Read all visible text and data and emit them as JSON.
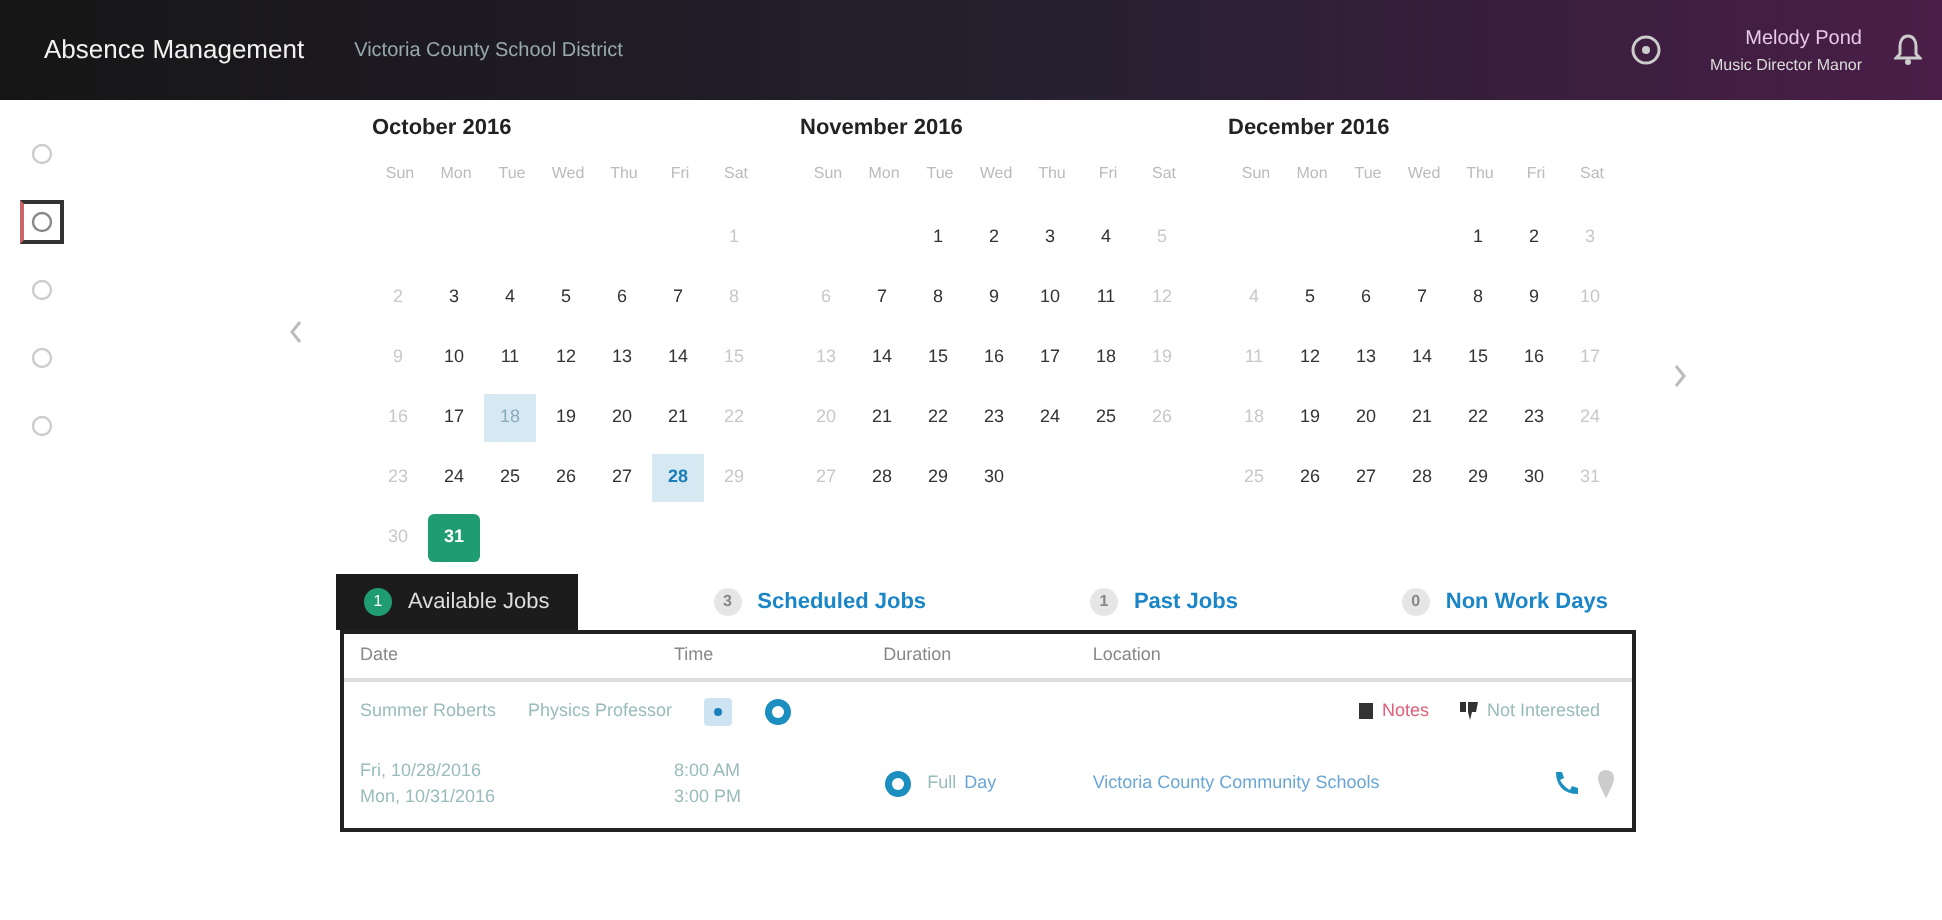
{
  "header": {
    "title": "Absence Management",
    "district": "Victoria County School District",
    "user_name": "Melody Pond",
    "user_role": "Music Director Manor"
  },
  "sidebar": {
    "items": [
      {
        "selected": false
      },
      {
        "selected": true
      },
      {
        "selected": false
      },
      {
        "selected": false
      },
      {
        "selected": false
      }
    ]
  },
  "months": [
    {
      "title": "October 2016",
      "weekdays": [
        "Sun",
        "Mon",
        "Tue",
        "Wed",
        "Thu",
        "Fri",
        "Sat"
      ],
      "weeks": [
        [
          {
            "kind": "blank"
          },
          {
            "kind": "blank"
          },
          {
            "kind": "blank"
          },
          {
            "kind": "blank"
          },
          {
            "kind": "blank"
          },
          {
            "kind": "blank"
          },
          {
            "text": "1",
            "kind": "weekend"
          }
        ],
        [
          {
            "text": "2",
            "kind": "weekend"
          },
          {
            "text": "3",
            "kind": "day"
          },
          {
            "text": "4",
            "kind": "day"
          },
          {
            "text": "5",
            "kind": "day"
          },
          {
            "text": "6",
            "kind": "day"
          },
          {
            "text": "7",
            "kind": "day"
          },
          {
            "text": "8",
            "kind": "weekend"
          }
        ],
        [
          {
            "text": "9",
            "kind": "weekend"
          },
          {
            "text": "10",
            "kind": "day"
          },
          {
            "text": "11",
            "kind": "day"
          },
          {
            "text": "12",
            "kind": "day"
          },
          {
            "text": "13",
            "kind": "day"
          },
          {
            "text": "14",
            "kind": "day"
          },
          {
            "text": "15",
            "kind": "weekend"
          }
        ],
        [
          {
            "text": "16",
            "kind": "weekend"
          },
          {
            "text": "17",
            "kind": "day"
          },
          {
            "text": "18",
            "kind": "light"
          },
          {
            "text": "19",
            "kind": "day"
          },
          {
            "text": "20",
            "kind": "day"
          },
          {
            "text": "21",
            "kind": "day"
          },
          {
            "text": "22",
            "kind": "weekend"
          }
        ],
        [
          {
            "text": "23",
            "kind": "weekend"
          },
          {
            "text": "24",
            "kind": "day"
          },
          {
            "text": "25",
            "kind": "day"
          },
          {
            "text": "26",
            "kind": "day"
          },
          {
            "text": "27",
            "kind": "day"
          },
          {
            "text": "28",
            "kind": "job"
          },
          {
            "text": "29",
            "kind": "weekend"
          }
        ],
        [
          {
            "text": "30",
            "kind": "weekend"
          },
          {
            "text": "31",
            "kind": "today"
          }
        ]
      ]
    },
    {
      "title": "November 2016",
      "weekdays": [
        "Sun",
        "Mon",
        "Tue",
        "Wed",
        "Thu",
        "Fri",
        "Sat"
      ],
      "weeks": [
        [
          {
            "kind": "blank"
          },
          {
            "kind": "blank"
          },
          {
            "text": "1",
            "kind": "day"
          },
          {
            "text": "2",
            "kind": "day"
          },
          {
            "text": "3",
            "kind": "day"
          },
          {
            "text": "4",
            "kind": "day"
          },
          {
            "text": "5",
            "kind": "weekend"
          }
        ],
        [
          {
            "text": "6",
            "kind": "weekend"
          },
          {
            "text": "7",
            "kind": "day"
          },
          {
            "text": "8",
            "kind": "day"
          },
          {
            "text": "9",
            "kind": "day"
          },
          {
            "text": "10",
            "kind": "day"
          },
          {
            "text": "11",
            "kind": "day"
          },
          {
            "text": "12",
            "kind": "weekend"
          }
        ],
        [
          {
            "text": "13",
            "kind": "weekend"
          },
          {
            "text": "14",
            "kind": "day"
          },
          {
            "text": "15",
            "kind": "day"
          },
          {
            "text": "16",
            "kind": "day"
          },
          {
            "text": "17",
            "kind": "day"
          },
          {
            "text": "18",
            "kind": "day"
          },
          {
            "text": "19",
            "kind": "weekend"
          }
        ],
        [
          {
            "text": "20",
            "kind": "weekend"
          },
          {
            "text": "21",
            "kind": "day"
          },
          {
            "text": "22",
            "kind": "day"
          },
          {
            "text": "23",
            "kind": "day"
          },
          {
            "text": "24",
            "kind": "day"
          },
          {
            "text": "25",
            "kind": "day"
          },
          {
            "text": "26",
            "kind": "weekend"
          }
        ],
        [
          {
            "text": "27",
            "kind": "weekend"
          },
          {
            "text": "28",
            "kind": "day"
          },
          {
            "text": "29",
            "kind": "day"
          },
          {
            "text": "30",
            "kind": "day"
          }
        ]
      ]
    },
    {
      "title": "December 2016",
      "weekdays": [
        "Sun",
        "Mon",
        "Tue",
        "Wed",
        "Thu",
        "Fri",
        "Sat"
      ],
      "weeks": [
        [
          {
            "kind": "blank"
          },
          {
            "kind": "blank"
          },
          {
            "kind": "blank"
          },
          {
            "kind": "blank"
          },
          {
            "text": "1",
            "kind": "day"
          },
          {
            "text": "2",
            "kind": "day"
          },
          {
            "text": "3",
            "kind": "weekend"
          }
        ],
        [
          {
            "text": "4",
            "kind": "weekend"
          },
          {
            "text": "5",
            "kind": "day"
          },
          {
            "text": "6",
            "kind": "day"
          },
          {
            "text": "7",
            "kind": "day"
          },
          {
            "text": "8",
            "kind": "day"
          },
          {
            "text": "9",
            "kind": "day"
          },
          {
            "text": "10",
            "kind": "weekend"
          }
        ],
        [
          {
            "text": "11",
            "kind": "weekend"
          },
          {
            "text": "12",
            "kind": "day"
          },
          {
            "text": "13",
            "kind": "day"
          },
          {
            "text": "14",
            "kind": "day"
          },
          {
            "text": "15",
            "kind": "day"
          },
          {
            "text": "16",
            "kind": "day"
          },
          {
            "text": "17",
            "kind": "weekend"
          }
        ],
        [
          {
            "text": "18",
            "kind": "weekend"
          },
          {
            "text": "19",
            "kind": "day"
          },
          {
            "text": "20",
            "kind": "day"
          },
          {
            "text": "21",
            "kind": "day"
          },
          {
            "text": "22",
            "kind": "day"
          },
          {
            "text": "23",
            "kind": "day"
          },
          {
            "text": "24",
            "kind": "weekend"
          }
        ],
        [
          {
            "text": "25",
            "kind": "weekend"
          },
          {
            "text": "26",
            "kind": "day"
          },
          {
            "text": "27",
            "kind": "day"
          },
          {
            "text": "28",
            "kind": "day"
          },
          {
            "text": "29",
            "kind": "day"
          },
          {
            "text": "30",
            "kind": "day"
          },
          {
            "text": "31",
            "kind": "weekend"
          }
        ]
      ]
    }
  ],
  "tabs": [
    {
      "label": "Available Jobs",
      "badge": "1",
      "selected": true
    },
    {
      "label": "Scheduled Jobs",
      "badge": "3",
      "selected": false
    },
    {
      "label": "Past Jobs",
      "badge": "1",
      "selected": false
    },
    {
      "label": "Non Work Days",
      "badge": "0",
      "selected": false
    }
  ],
  "table": {
    "columns": [
      "Date",
      "Time",
      "Duration",
      "Location"
    ],
    "job": {
      "employee": "Summer Roberts",
      "position": "Physics Professor",
      "notes": "Notes",
      "not_interested": "Not Interested",
      "dates": [
        "Fri, 10/28/2016",
        "Mon, 10/31/2016"
      ],
      "times": [
        "8:00 AM",
        "3:00 PM"
      ],
      "duration": "Full",
      "duration_unit": "Day",
      "location": "Victoria County Community Schools"
    }
  }
}
